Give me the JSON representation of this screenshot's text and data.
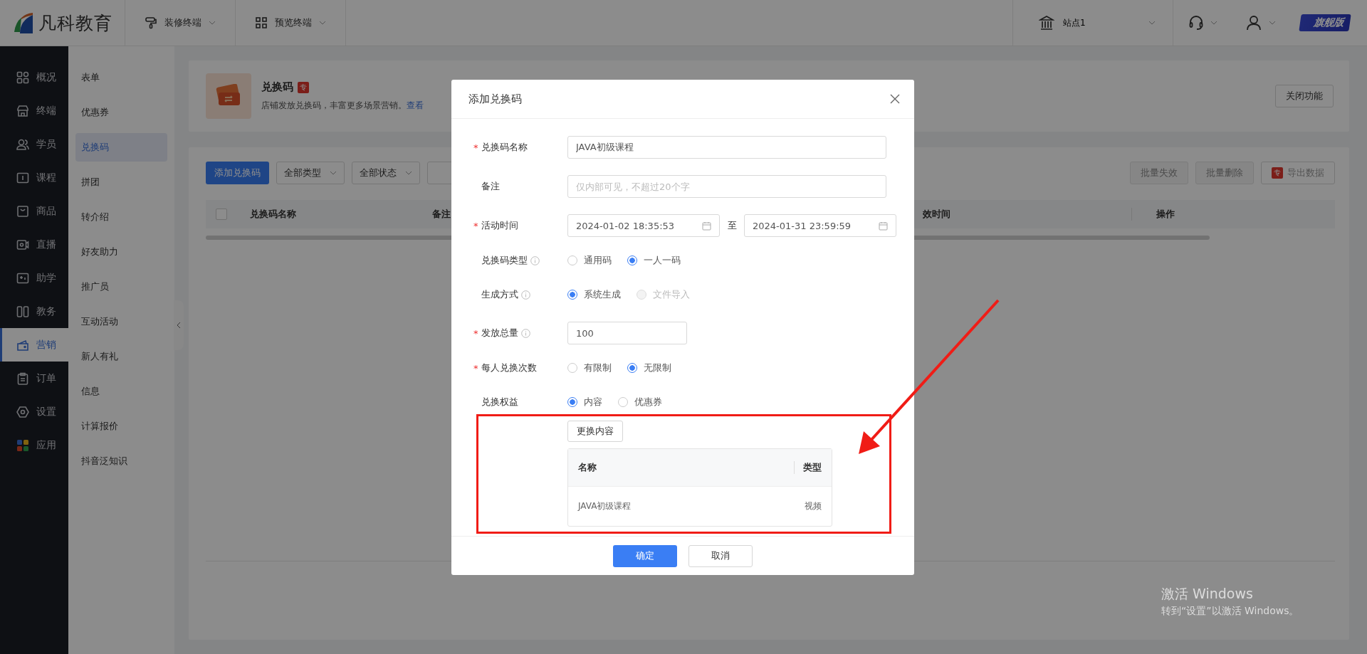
{
  "top_bar": {
    "logo_text": "凡科教育",
    "menus": [
      {
        "label": "装修终端"
      },
      {
        "label": "预览终端"
      }
    ],
    "site": "站点1",
    "edition_badge": "旗舰版"
  },
  "main_nav": [
    {
      "label": "概况",
      "selected": false
    },
    {
      "label": "终端",
      "selected": false
    },
    {
      "label": "学员",
      "selected": false
    },
    {
      "label": "课程",
      "selected": false
    },
    {
      "label": "商品",
      "selected": false
    },
    {
      "label": "直播",
      "selected": false
    },
    {
      "label": "助学",
      "selected": false
    },
    {
      "label": "教务",
      "selected": false
    },
    {
      "label": "营销",
      "selected": true
    },
    {
      "label": "订单",
      "selected": false
    },
    {
      "label": "设置",
      "selected": false
    },
    {
      "label": "应用",
      "selected": false
    }
  ],
  "sub_nav": [
    {
      "label": "表单",
      "selected": false
    },
    {
      "label": "优惠券",
      "selected": false
    },
    {
      "label": "兑换码",
      "selected": true
    },
    {
      "label": "拼团",
      "selected": false
    },
    {
      "label": "转介绍",
      "selected": false
    },
    {
      "label": "好友助力",
      "selected": false
    },
    {
      "label": "推广员",
      "selected": false
    },
    {
      "label": "互动活动",
      "selected": false
    },
    {
      "label": "新人有礼",
      "selected": false
    },
    {
      "label": "信息",
      "selected": false
    },
    {
      "label": "计算报价",
      "selected": false
    },
    {
      "label": "抖音泛知识",
      "selected": false
    }
  ],
  "feature_header": {
    "title": "兑换码",
    "pro_badge": "专",
    "description": "店铺发放兑换码，丰富更多场景营销。",
    "link": "查看",
    "close_button": "关闭功能"
  },
  "toolbar": {
    "add_button": "添加兑换码",
    "filters": [
      "全部类型",
      "全部状态"
    ],
    "batch_buttons": [
      {
        "label": "批量失效",
        "disabled": true
      },
      {
        "label": "批量删除",
        "disabled": true
      }
    ],
    "export": {
      "badge": "专",
      "label": "导出数据"
    }
  },
  "list_table": {
    "select_all_checked": false,
    "columns": [
      "兑换码名称",
      "备注",
      "效时间",
      "操作"
    ]
  },
  "dialog": {
    "title": "添加兑换码",
    "required_mark": "*",
    "fields": [
      {
        "kind": "text",
        "label": "兑换码名称",
        "required": true,
        "info": false,
        "value": "JAVA初级课程"
      },
      {
        "kind": "text",
        "label": "备注",
        "required": false,
        "info": false,
        "placeholder": "仅内部可见，不超过20个字"
      },
      {
        "kind": "date_range",
        "label": "活动时间",
        "required": true,
        "info": false,
        "start": "2024-01-02 18:35:53",
        "separator": "至",
        "end": "2024-01-31 23:59:59"
      },
      {
        "kind": "radio",
        "label": "兑换码类型",
        "required": false,
        "info": true,
        "options": [
          {
            "label": "通用码",
            "selected": false,
            "disabled": false
          },
          {
            "label": "一人一码",
            "selected": true,
            "disabled": false
          }
        ]
      },
      {
        "kind": "radio",
        "label": "生成方式",
        "required": false,
        "info": true,
        "options": [
          {
            "label": "系统生成",
            "selected": true,
            "disabled": false
          },
          {
            "label": "文件导入",
            "selected": false,
            "disabled": true
          }
        ]
      },
      {
        "kind": "number",
        "label": "发放总量",
        "required": true,
        "info": true,
        "value": "100"
      },
      {
        "kind": "radio",
        "label": "每人兑换次数",
        "required": true,
        "info": false,
        "options": [
          {
            "label": "有限制",
            "selected": false,
            "disabled": false
          },
          {
            "label": "无限制",
            "selected": true,
            "disabled": false
          }
        ]
      },
      {
        "kind": "radio",
        "label": "兑换权益",
        "required": false,
        "info": false,
        "options": [
          {
            "label": "内容",
            "selected": true,
            "disabled": false
          },
          {
            "label": "优惠券",
            "selected": false,
            "disabled": false
          }
        ]
      }
    ],
    "content": {
      "change_button": "更换内容",
      "columns": [
        "名称",
        "类型"
      ],
      "rows": [
        [
          "JAVA初级课程",
          "视频"
        ]
      ]
    },
    "ok_button": "确定",
    "cancel_button": "取消"
  },
  "os_watermark": {
    "title": "激活 Windows",
    "subtitle": "转到“设置”以激活 Windows。"
  }
}
